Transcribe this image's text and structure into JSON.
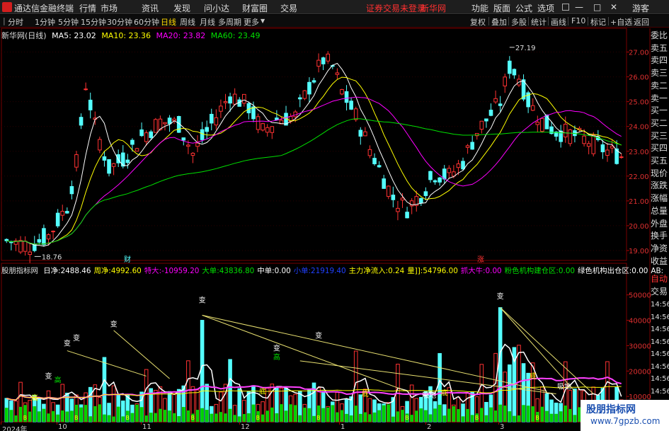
{
  "app": {
    "title": "通达信金融终端",
    "menus": [
      "行情",
      "市场",
      "资讯",
      "发现",
      "问小达",
      "财富圈",
      "交易"
    ],
    "login_notice": "证券交易未登录",
    "brand": "新华网",
    "right_menus": [
      "功能",
      "版面",
      "公式",
      "选项"
    ],
    "guest": "游客"
  },
  "toolbar": {
    "periods": [
      "分时",
      "1分钟",
      "5分钟",
      "15分钟",
      "30分钟",
      "60分钟",
      "日线",
      "周线",
      "月线",
      "多周期",
      "更多"
    ],
    "selected": "日线",
    "right_items": [
      "复权",
      "叠加",
      "多股",
      "统计",
      "画线",
      "F10",
      "标记",
      "+自选",
      "返回"
    ]
  },
  "main_chart": {
    "stock_label": "新华网(日线)",
    "ma": [
      {
        "name": "MA5",
        "value": "23.02",
        "color": "#ffffff"
      },
      {
        "name": "MA10",
        "value": "23.36",
        "color": "#ffff00"
      },
      {
        "name": "MA20",
        "value": "23.82",
        "color": "#ff00ff"
      },
      {
        "name": "MA60",
        "value": "23.49",
        "color": "#00e000"
      }
    ],
    "price_ticks": [
      "27.00",
      "26.00",
      "25.00",
      "24.00",
      "23.00",
      "22.00",
      "21.00",
      "20.00",
      "19.00"
    ],
    "high_label": "27.19",
    "low_label": "18.76",
    "marker_cai": "财",
    "marker_zhang": "涨"
  },
  "chart_data": {
    "type": "candlestick",
    "ylim": [
      18.6,
      27.5
    ],
    "y_ticks": [
      27,
      26,
      25,
      24,
      23,
      22,
      21,
      20,
      19
    ],
    "high": 27.19,
    "low": 18.76
  },
  "indicator": {
    "name": "股朋指标网",
    "fields": [
      {
        "label": "日净:",
        "value": "2488.46",
        "color": "#ffffff"
      },
      {
        "label": "周净:",
        "value": "4992.60",
        "color": "#ffff00"
      },
      {
        "label": "特大:",
        "value": "-10959.20",
        "color": "#ff00ff"
      },
      {
        "label": "大单:",
        "value": "43836.80",
        "color": "#00e000"
      },
      {
        "label": "中单:",
        "value": "0.00",
        "color": "#ffffff"
      },
      {
        "label": "小单:",
        "value": "21919.40",
        "color": "#2040ff"
      },
      {
        "label": "主力净流入:",
        "value": "0.24",
        "color": "#ffff00"
      },
      {
        "label": "量]]:",
        "value": "54796.00",
        "color": "#ffff00"
      },
      {
        "label": "抓大牛:",
        "value": "0.00",
        "color": "#ff00ff"
      },
      {
        "label": "粉色机构建仓区:",
        "value": "0.00",
        "color": "#00e000"
      },
      {
        "label": "绿色机构出仓区:",
        "value": "0.00",
        "color": "#ffffff"
      },
      {
        "label": "AB:",
        "value": "",
        "color": "#ffffff"
      }
    ],
    "y_ticks": [
      "50000",
      "40000",
      "30000",
      "20000",
      "10000"
    ],
    "bian": "变",
    "di": "底",
    "gao": "高",
    "qi": "企",
    "zhang": "涨",
    "xidi": "吸地",
    "b": "B"
  },
  "dates": [
    "2024年",
    "10",
    "11",
    "12",
    "1",
    "2",
    "3"
  ],
  "right_panel": {
    "items": [
      "委比",
      "卖五",
      "卖四",
      "卖三",
      "卖二",
      "卖一",
      "买一",
      "买二",
      "买三",
      "买四",
      "买五",
      "现价",
      "涨跌",
      "涨幅",
      "总量",
      "外盘",
      "换手",
      "净资",
      "收益"
    ],
    "tabs": [
      "自动",
      "交易"
    ],
    "time_label": "14:56"
  },
  "watermark": {
    "line1": "股朋指标网",
    "line2": "www.7gpzb.com"
  }
}
